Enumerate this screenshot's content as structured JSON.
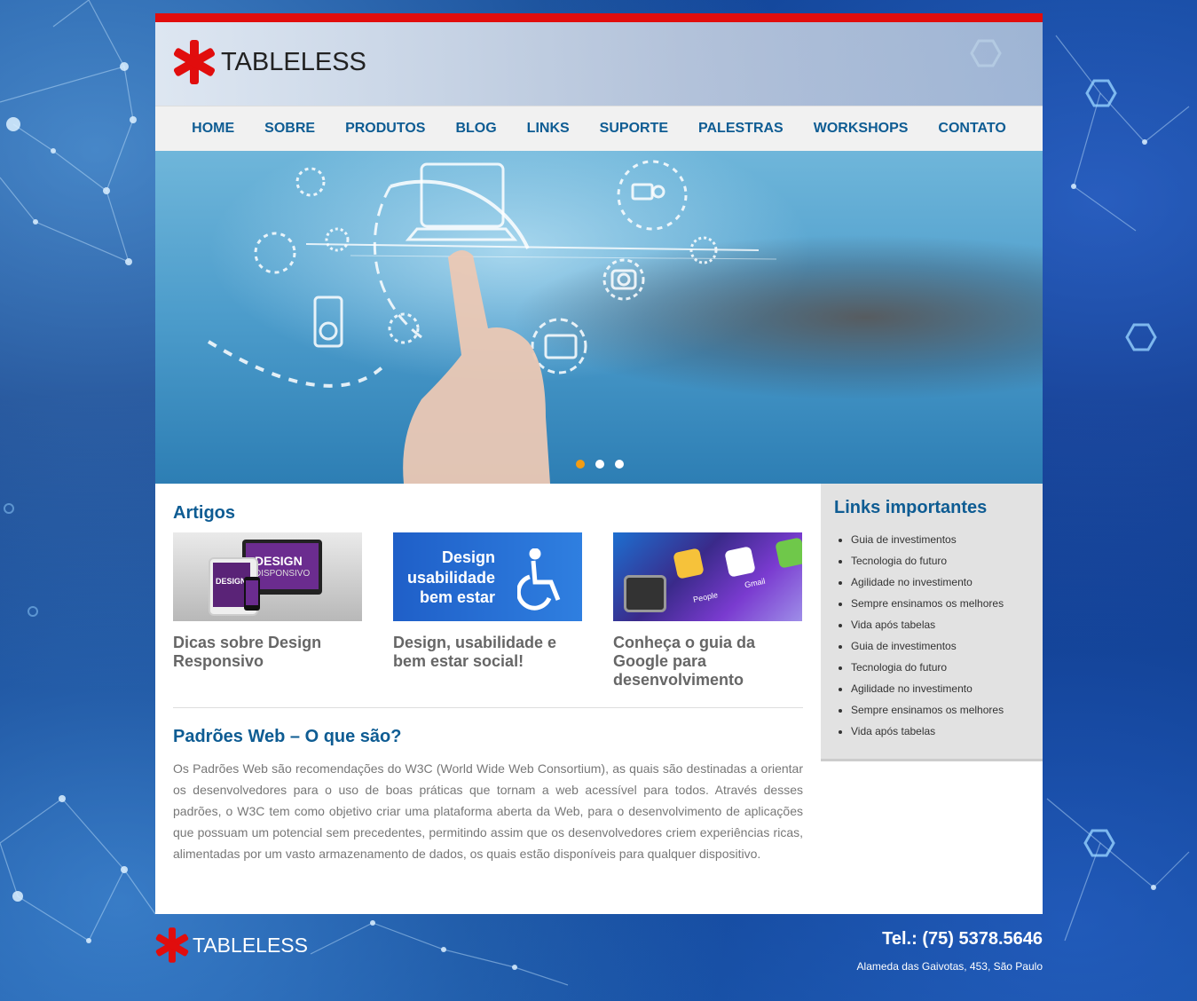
{
  "header": {
    "logo_text": "TABLELESS"
  },
  "nav": {
    "items": [
      "HOME",
      "SOBRE",
      "PRODUTOS",
      "BLOG",
      "LINKS",
      "SUPORTE",
      "PALESTRAS",
      "WORKSHOPS",
      "CONTATO"
    ]
  },
  "slider": {
    "dot_count": 3,
    "active_index": 0
  },
  "artigos": {
    "heading": "Artigos",
    "cards": [
      {
        "title": "Dicas sobre Design Responsivo",
        "thumb_text": [
          "DESIGN",
          "DISPONSIVO",
          "DESIGN"
        ]
      },
      {
        "title": "Design, usabilidade e bem estar social!",
        "thumb_text": [
          "Design",
          "usabilidade",
          "bem estar"
        ]
      },
      {
        "title": "Conheça o guia da Google para desenvolvimento",
        "thumb_text": [
          "People",
          "Gmail"
        ]
      }
    ]
  },
  "article": {
    "heading": "Padrões Web – O que são?",
    "body": "Os Padrões Web são recomendações do W3C (World Wide Web Consortium), as quais são destinadas a orientar os desenvolvedores para o uso de boas práticas que tornam a web acessível para todos. Através desses padrões, o W3C tem como objetivo criar uma plataforma aberta da Web, para o desenvolvimento de aplicações que possuam um potencial sem precedentes, permitindo assim que os desenvolvedores criem experiências ricas, alimentadas por um vasto armazenamento de dados, os quais estão disponíveis para qualquer dispositivo."
  },
  "sidebar": {
    "heading": "Links importantes",
    "links": [
      "Guia de investimentos",
      "Tecnologia do futuro",
      "Agilidade no investimento",
      "Sempre ensinamos os melhores",
      "Vida após tabelas",
      "Guia de investimentos",
      "Tecnologia do futuro",
      "Agilidade no investimento",
      "Sempre ensinamos os melhores",
      "Vida após tabelas"
    ]
  },
  "footer": {
    "logo_text": "TABLELESS",
    "phone": "Tel.: (75) 5378.5646",
    "address": "Alameda das Gaivotas, 453, São Paulo"
  },
  "colors": {
    "accent": "#e10d0d",
    "link_blue": "#0e5c93",
    "dot_active": "#f39c12"
  }
}
